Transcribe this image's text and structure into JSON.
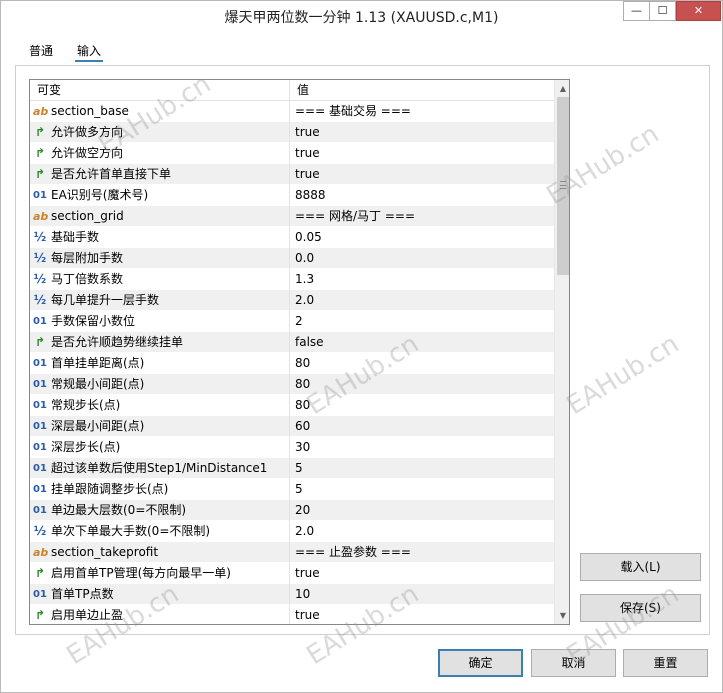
{
  "window": {
    "title": "爆天甲两位数一分钟 1.13 (XAUUSD.c,M1)",
    "minimize_glyph": "—",
    "maximize_glyph": "☐",
    "close_glyph": "✕"
  },
  "tabs": [
    {
      "label": "普通"
    },
    {
      "label": "输入"
    }
  ],
  "table": {
    "headers": {
      "variable": "可变",
      "value": "值"
    },
    "rows": [
      {
        "icon": "ab",
        "name": "section_base",
        "value": "=== 基础交易 ==="
      },
      {
        "icon": "bool",
        "name": "允许做多方向",
        "value": "true"
      },
      {
        "icon": "bool",
        "name": "允许做空方向",
        "value": "true"
      },
      {
        "icon": "bool",
        "name": "是否允许首单直接下单",
        "value": "true"
      },
      {
        "icon": "01",
        "name": "EA识别号(魔术号)",
        "value": "8888"
      },
      {
        "icon": "ab",
        "name": "section_grid",
        "value": "=== 网格/马丁 ==="
      },
      {
        "icon": "half",
        "name": "基础手数",
        "value": "0.05"
      },
      {
        "icon": "half",
        "name": "每层附加手数",
        "value": "0.0"
      },
      {
        "icon": "half",
        "name": "马丁倍数系数",
        "value": "1.3"
      },
      {
        "icon": "half",
        "name": "每几单提升一层手数",
        "value": "2.0"
      },
      {
        "icon": "01",
        "name": "手数保留小数位",
        "value": "2"
      },
      {
        "icon": "bool",
        "name": "是否允许顺趋势继续挂单",
        "value": "false"
      },
      {
        "icon": "01",
        "name": "首单挂单距离(点)",
        "value": "80"
      },
      {
        "icon": "01",
        "name": "常规最小间距(点)",
        "value": "80"
      },
      {
        "icon": "01",
        "name": "常规步长(点)",
        "value": "80"
      },
      {
        "icon": "01",
        "name": "深层最小间距(点)",
        "value": "60"
      },
      {
        "icon": "01",
        "name": "深层步长(点)",
        "value": "30"
      },
      {
        "icon": "01",
        "name": "超过该单数后使用Step1/MinDistance1",
        "value": "5"
      },
      {
        "icon": "01",
        "name": "挂单跟随调整步长(点)",
        "value": "5"
      },
      {
        "icon": "01",
        "name": "单边最大层数(0=不限制)",
        "value": "20"
      },
      {
        "icon": "half",
        "name": "单次下单最大手数(0=不限制)",
        "value": "2.0"
      },
      {
        "icon": "ab",
        "name": "section_takeprofit",
        "value": "=== 止盈参数 ==="
      },
      {
        "icon": "bool",
        "name": "启用首单TP管理(每方向最早一单)",
        "value": "true"
      },
      {
        "icon": "01",
        "name": "首单TP点数",
        "value": "10"
      },
      {
        "icon": "bool",
        "name": "启用单边止盈",
        "value": "true"
      }
    ]
  },
  "icons": {
    "ab": "ab",
    "01": "01",
    "half": "½",
    "bool": "↱"
  },
  "scrollbar": {
    "up": "▲",
    "down": "▼"
  },
  "buttons": {
    "load": "载入(L)",
    "save": "保存(S)",
    "ok": "确定",
    "cancel": "取消",
    "reset": "重置"
  },
  "watermark": "EAHub.cn"
}
